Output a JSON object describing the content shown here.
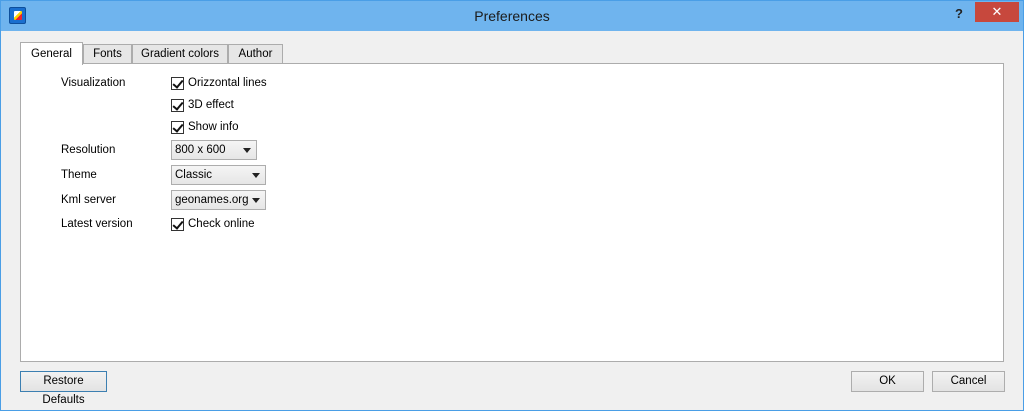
{
  "window": {
    "title": "Preferences",
    "help_label": "?",
    "close_label": "✕"
  },
  "tabs": [
    {
      "label": "General",
      "active": true
    },
    {
      "label": "Fonts",
      "active": false
    },
    {
      "label": "Gradient colors",
      "active": false
    },
    {
      "label": "Author",
      "active": false
    }
  ],
  "general": {
    "visualization": {
      "label": "Visualization",
      "options": [
        {
          "label": "Orizzontal lines",
          "checked": true
        },
        {
          "label": "3D effect",
          "checked": true
        },
        {
          "label": "Show info",
          "checked": true
        }
      ]
    },
    "resolution": {
      "label": "Resolution",
      "value": "800 x 600"
    },
    "theme": {
      "label": "Theme",
      "value": "Classic"
    },
    "kml_server": {
      "label": "Kml server",
      "value": "geonames.org"
    },
    "latest_version": {
      "label": "Latest version",
      "option": {
        "label": "Check online",
        "checked": true
      }
    }
  },
  "buttons": {
    "restore": "Restore Defaults",
    "ok": "OK",
    "cancel": "Cancel"
  }
}
